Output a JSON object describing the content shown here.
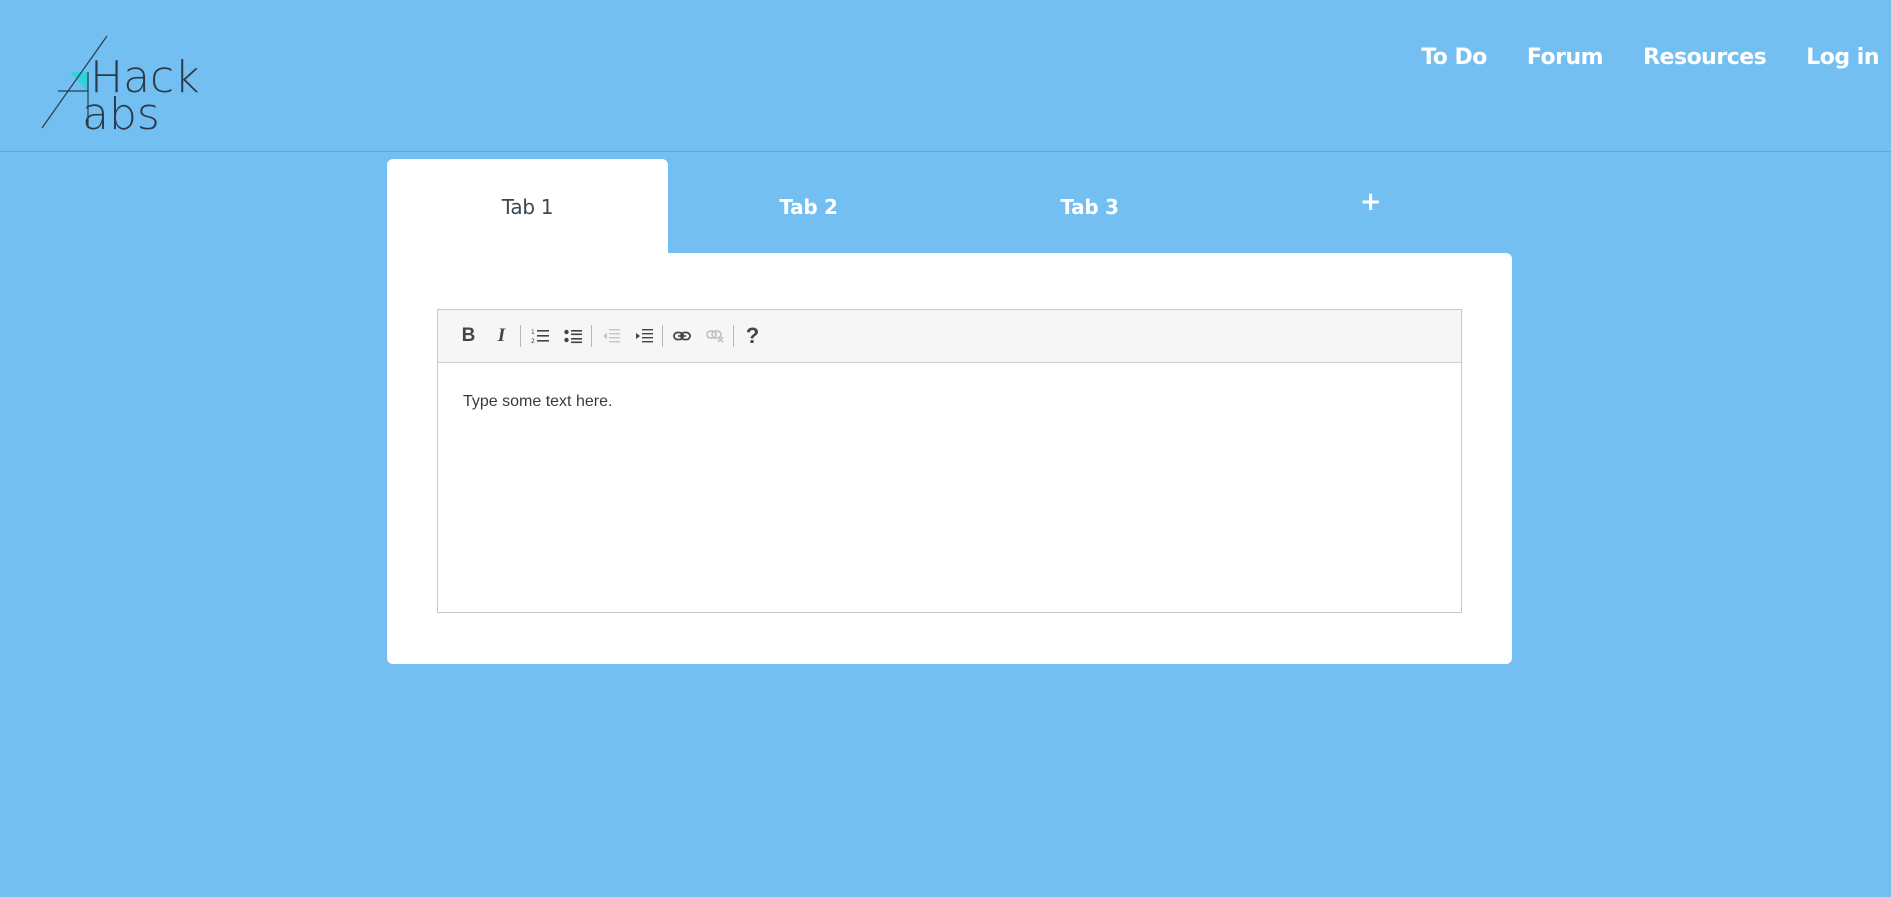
{
  "brand": {
    "logo_text": "HackTabs",
    "line1": "Hack",
    "line2": "abs"
  },
  "nav": {
    "items": [
      {
        "label": "To Do"
      },
      {
        "label": "Forum"
      },
      {
        "label": "Resources"
      },
      {
        "label": "Log in"
      }
    ]
  },
  "tabs": [
    {
      "label": "Tab 1",
      "active": true
    },
    {
      "label": "Tab 2",
      "active": false
    },
    {
      "label": "Tab 3",
      "active": false
    }
  ],
  "add_tab": {
    "label": "+"
  },
  "toolbar": {
    "buttons": [
      {
        "name": "bold",
        "label": "B",
        "icon": "bold-icon",
        "enabled": true
      },
      {
        "name": "italic",
        "label": "I",
        "icon": "italic-icon",
        "enabled": true
      },
      {
        "name": "ordered-list",
        "icon": "ordered-list-icon",
        "enabled": true
      },
      {
        "name": "unordered-list",
        "icon": "unordered-list-icon",
        "enabled": true
      },
      {
        "name": "outdent",
        "icon": "outdent-icon",
        "enabled": false
      },
      {
        "name": "indent",
        "icon": "indent-icon",
        "enabled": true
      },
      {
        "name": "link",
        "icon": "link-icon",
        "enabled": true
      },
      {
        "name": "unlink",
        "icon": "unlink-icon",
        "enabled": false
      },
      {
        "name": "help",
        "label": "?",
        "icon": "help-icon",
        "enabled": true
      }
    ]
  },
  "editor": {
    "content": "Type some text here."
  },
  "colors": {
    "background": "#73bff2",
    "panel": "#ffffff",
    "active_tab_text": "#3d4650",
    "logo_accent": "#2bd4d6"
  }
}
